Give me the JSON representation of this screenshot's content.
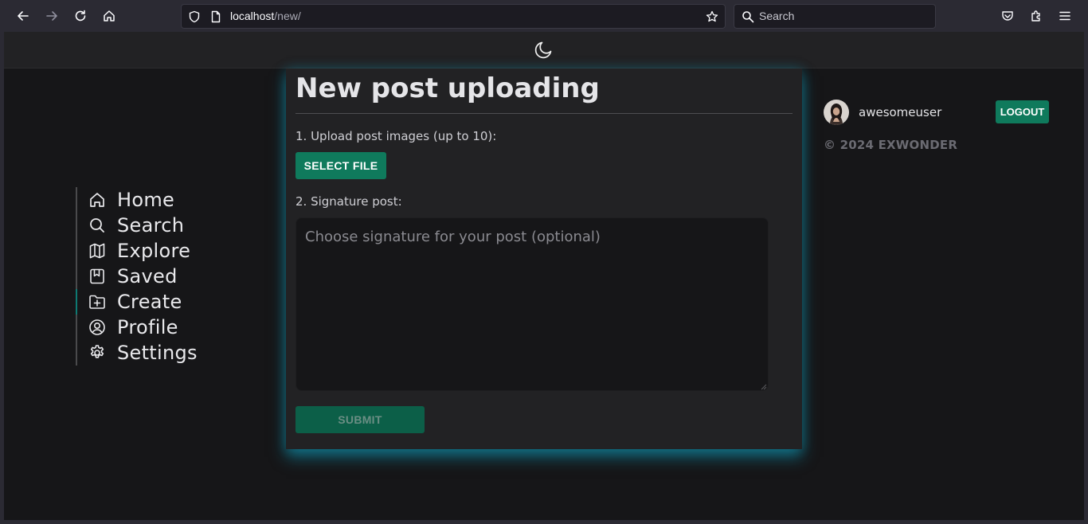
{
  "browser": {
    "url_host": "localhost",
    "url_path": "/new/",
    "search_placeholder": "Search"
  },
  "sidebar": {
    "items": [
      {
        "label": "Home",
        "icon": "home-icon"
      },
      {
        "label": "Search",
        "icon": "search-icon"
      },
      {
        "label": "Explore",
        "icon": "map-icon"
      },
      {
        "label": "Saved",
        "icon": "bookmark-icon"
      },
      {
        "label": "Create",
        "icon": "folder-plus-icon",
        "active": true
      },
      {
        "label": "Profile",
        "icon": "user-circle-icon"
      },
      {
        "label": "Settings",
        "icon": "gear-icon"
      }
    ]
  },
  "form": {
    "title": "New post uploading",
    "step1_label": "1. Upload post images (up to 10):",
    "select_file_label": "SELECT FILE",
    "step2_label": "2. Signature post:",
    "signature_placeholder": "Choose signature for your post (optional)",
    "submit_label": "SUBMIT"
  },
  "user": {
    "username": "awesomeuser",
    "logout_label": "LOGOUT"
  },
  "footer": {
    "copyright": "© 2024 EXWONDER"
  },
  "colors": {
    "accent": "#0f7a5c",
    "glow": "#0fa8c8",
    "page_bg": "#161618",
    "card_bg": "#222224"
  }
}
